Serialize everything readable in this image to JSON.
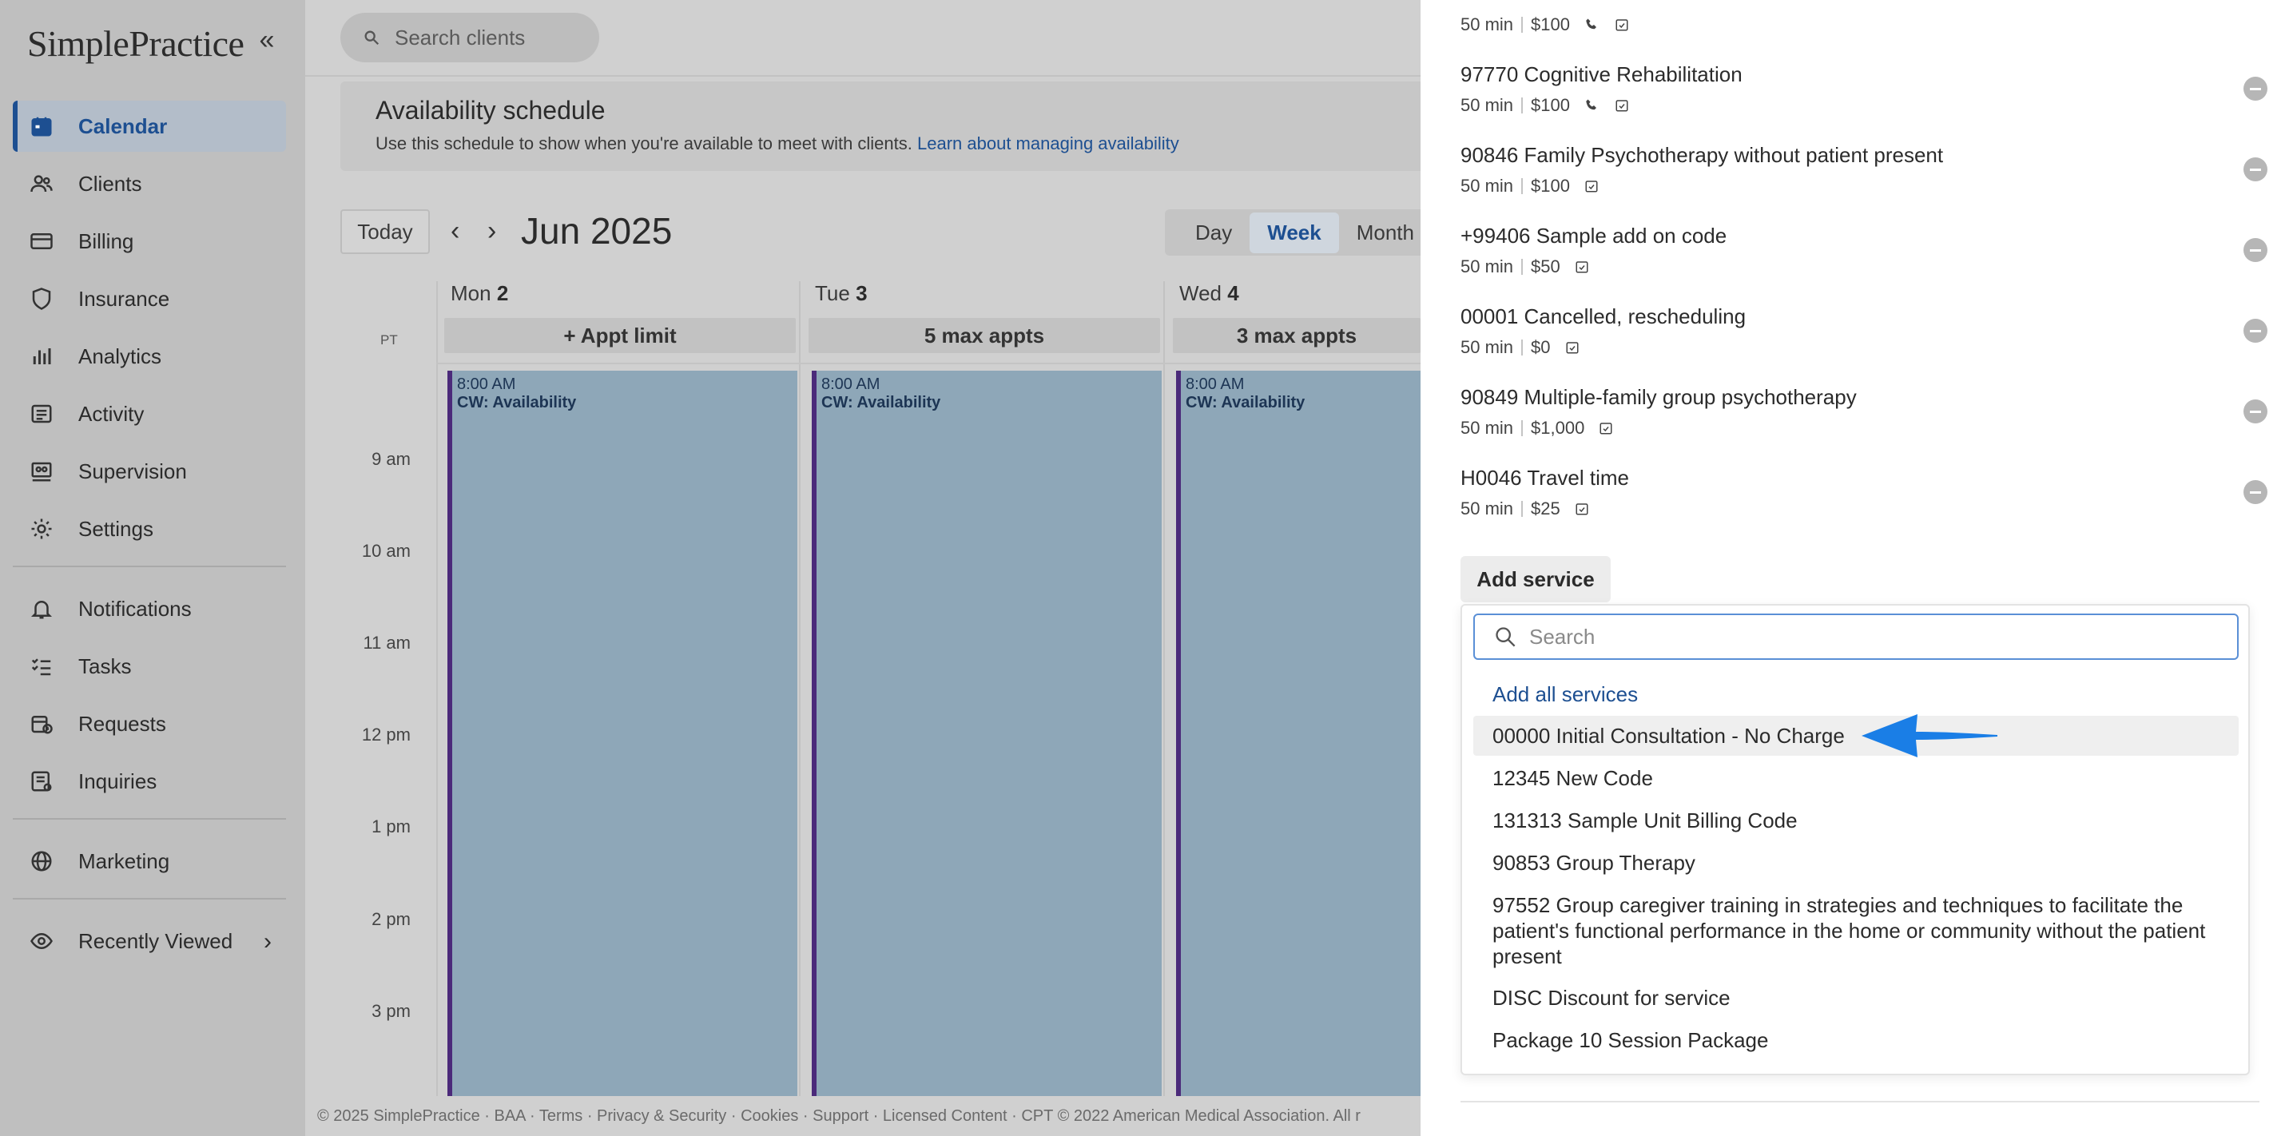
{
  "app": {
    "logo": "SimplePractice",
    "collapse_glyph": "«"
  },
  "sidebar": {
    "items": [
      {
        "label": "Calendar",
        "icon": "calendar-icon",
        "active": true
      },
      {
        "label": "Clients",
        "icon": "users-icon"
      },
      {
        "label": "Billing",
        "icon": "credit-card-icon"
      },
      {
        "label": "Insurance",
        "icon": "shield-icon"
      },
      {
        "label": "Analytics",
        "icon": "bar-chart-icon"
      },
      {
        "label": "Activity",
        "icon": "list-icon"
      },
      {
        "label": "Supervision",
        "icon": "supervision-icon"
      },
      {
        "label": "Settings",
        "icon": "gear-icon"
      }
    ],
    "items2": [
      {
        "label": "Notifications",
        "icon": "bell-icon"
      },
      {
        "label": "Tasks",
        "icon": "checklist-icon"
      },
      {
        "label": "Requests",
        "icon": "calendar-request-icon"
      },
      {
        "label": "Inquiries",
        "icon": "inquiry-icon"
      }
    ],
    "marketing": {
      "label": "Marketing",
      "icon": "globe-icon"
    },
    "recently_viewed": {
      "label": "Recently Viewed",
      "icon": "eye-icon",
      "chevron": "›"
    }
  },
  "search": {
    "placeholder": "Search clients"
  },
  "availability": {
    "title": "Availability schedule",
    "subtitle": "Use this schedule to show when you're available to meet with clients.",
    "link": "Learn about managing availability"
  },
  "calendar": {
    "today_label": "Today",
    "prev": "‹",
    "next": "›",
    "month": "Jun 2025",
    "views": [
      "Day",
      "Week",
      "Month"
    ],
    "active_view": "Week",
    "timezone": "PT",
    "days": [
      {
        "name": "Mon",
        "num": "2",
        "limit": "+ Appt limit"
      },
      {
        "name": "Tue",
        "num": "3",
        "limit": "5 max appts"
      },
      {
        "name": "Wed",
        "num": "4",
        "limit": "3 max appts"
      }
    ],
    "times": [
      "9 am",
      "10 am",
      "11 am",
      "12 pm",
      "1 pm",
      "2 pm",
      "3 pm"
    ],
    "block": {
      "time": "8:00 AM",
      "label": "CW: Availability"
    }
  },
  "footer": "© 2025 SimplePractice · BAA · Terms · Privacy & Security · Cookies · Support · Licensed Content · CPT © 2022 American Medical Association. All r",
  "services": [
    {
      "name": "",
      "duration": "50 min",
      "price": "$100",
      "phone": true,
      "remove": false
    },
    {
      "name": "97770 Cognitive Rehabilitation",
      "duration": "50 min",
      "price": "$100",
      "phone": true,
      "remove": true
    },
    {
      "name": "90846 Family Psychotherapy without patient present",
      "duration": "50 min",
      "price": "$100",
      "phone": false,
      "remove": true
    },
    {
      "name": "+99406 Sample add on code",
      "duration": "50 min",
      "price": "$50",
      "phone": false,
      "remove": true
    },
    {
      "name": "00001 Cancelled, rescheduling",
      "duration": "50 min",
      "price": "$0",
      "phone": false,
      "remove": true
    },
    {
      "name": "90849 Multiple-family group psychotherapy",
      "duration": "50 min",
      "price": "$1,000",
      "phone": false,
      "remove": true
    },
    {
      "name": "H0046 Travel time",
      "duration": "50 min",
      "price": "$25",
      "phone": false,
      "remove": true
    }
  ],
  "add_service": {
    "button": "Add service",
    "search_placeholder": "Search",
    "add_all": "Add all services",
    "options": [
      "00000 Initial Consultation - No Charge",
      "12345 New Code",
      "131313 Sample Unit Billing Code",
      "90853 Group Therapy",
      "97552 Group caregiver training in strategies and techniques to facilitate the patient's functional performance in the home or community without the patient present",
      "DISC Discount for service",
      "Package 10 Session Package"
    ],
    "highlighted_index": 0
  },
  "colors": {
    "accent": "#1d4f91",
    "availability_block": "#8ea7b8",
    "block_border": "#4b2a7a",
    "pointer_arrow": "#1a7ee6"
  }
}
